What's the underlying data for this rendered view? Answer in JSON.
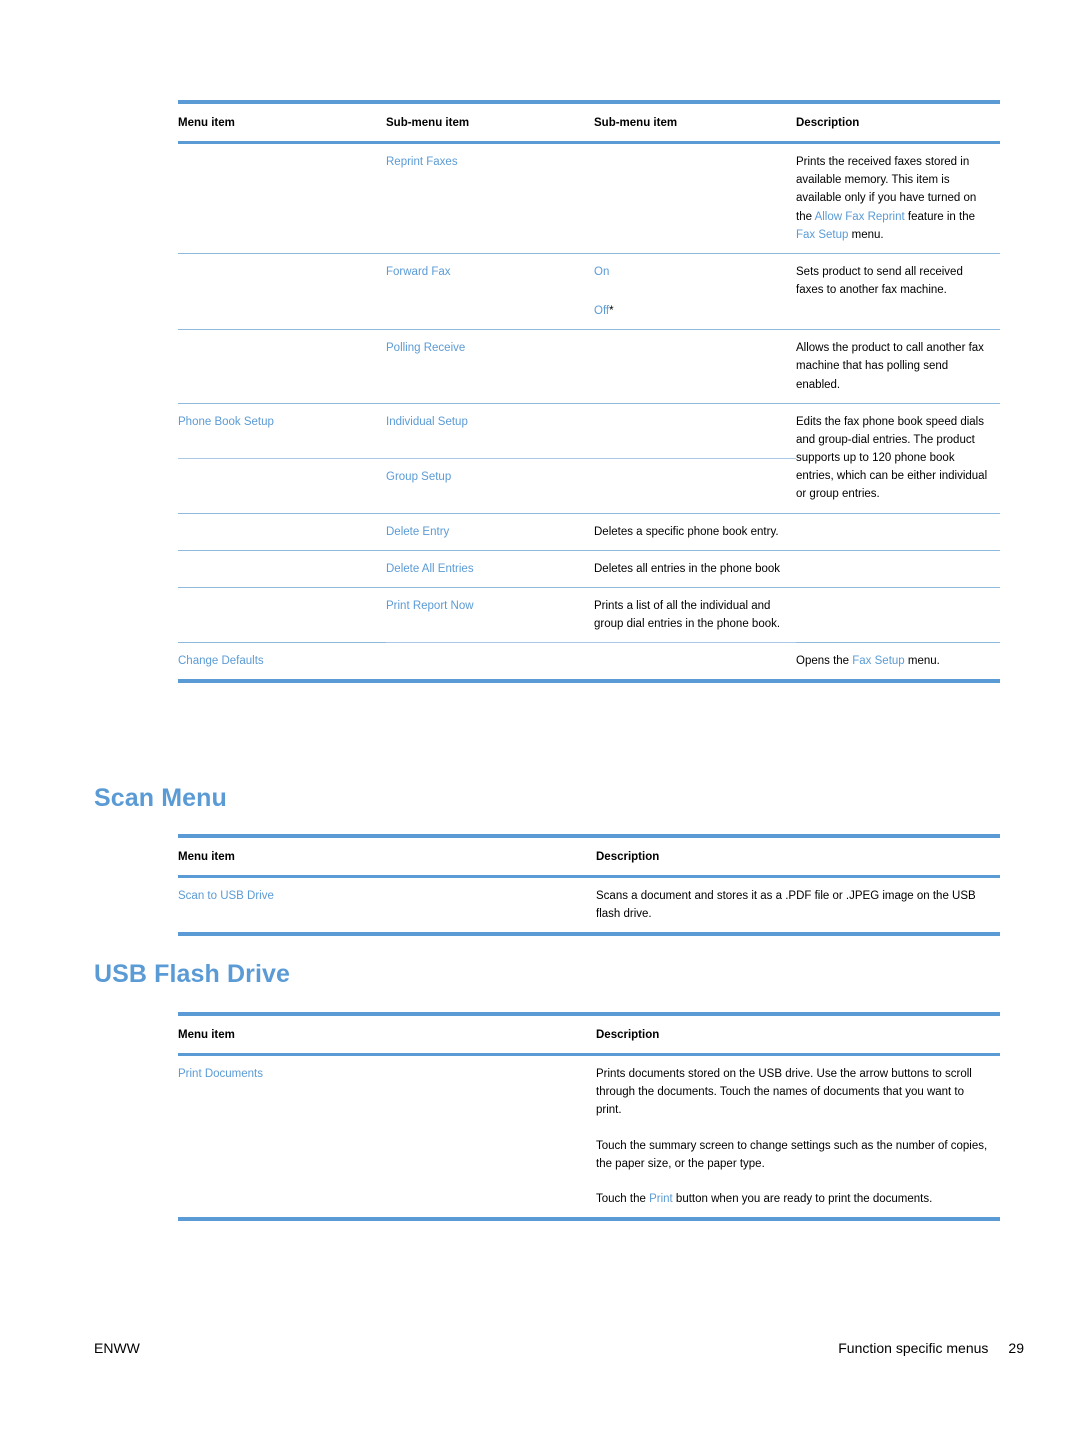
{
  "page": {
    "footer_left": "ENWW",
    "footer_right_label": "Function specific menus",
    "footer_page_number": "29"
  },
  "colors": {
    "accent": "#5b9bd5",
    "rule": "#8fb9dd",
    "text": "#000000"
  },
  "fax_table": {
    "headers": {
      "menu_item": "Menu item",
      "sub_menu_item_1": "Sub-menu item",
      "sub_menu_item_2": "Sub-menu item",
      "description": "Description"
    },
    "rows": [
      {
        "menu_item": "",
        "sub1": "Reprint Faxes",
        "sub2": "",
        "desc_parts": [
          {
            "text": "Prints the received faxes stored in available memory. This item is available only if you have turned on the ",
            "link": false
          },
          {
            "text": "Allow Fax Reprint",
            "link": true
          },
          {
            "text": " feature in the ",
            "link": false
          },
          {
            "text": "Fax Setup",
            "link": true
          },
          {
            "text": " menu.",
            "link": false
          }
        ]
      },
      {
        "menu_item": "",
        "sub1": "Forward Fax",
        "sub2_a": "On",
        "sub2_b": "Off",
        "sub2_b_asterisk": "*",
        "desc": "Sets product to send all received faxes to another fax machine."
      },
      {
        "menu_item": "",
        "sub1": "Polling Receive",
        "sub2": "",
        "desc": "Allows the product to call another fax machine that has polling send enabled."
      },
      {
        "menu_item": "Phone Book Setup",
        "sub1": "Individual Setup",
        "sub1_b": "Group Setup",
        "sub2": "",
        "desc": "Edits the fax phone book speed dials and group-dial entries. The product supports up to 120 phone book entries, which can be either individual or group entries."
      },
      {
        "menu_item": "",
        "sub1": "Delete Entry",
        "sub2": "Deletes a specific phone book entry.",
        "desc": ""
      },
      {
        "menu_item": "",
        "sub1": "Delete All Entries",
        "sub2": "Deletes all entries in the phone book",
        "desc": ""
      },
      {
        "menu_item": "",
        "sub1": "Print Report Now",
        "sub2": "Prints a list of all the individual and group dial entries in the phone book.",
        "desc": ""
      },
      {
        "menu_item": "Change Defaults",
        "sub1": "",
        "sub2": "",
        "desc_parts": [
          {
            "text": "Opens the ",
            "link": false
          },
          {
            "text": "Fax Setup",
            "link": true
          },
          {
            "text": " menu.",
            "link": false
          }
        ]
      }
    ]
  },
  "scan_section": {
    "heading": "Scan Menu",
    "headers": {
      "menu_item": "Menu item",
      "description": "Description"
    },
    "rows": [
      {
        "menu_item": "Scan to USB Drive",
        "desc": "Scans a document and stores it as a .PDF file or .JPEG image on the USB flash drive."
      }
    ]
  },
  "usb_section": {
    "heading": "USB Flash Drive",
    "headers": {
      "menu_item": "Menu item",
      "description": "Description"
    },
    "rows": [
      {
        "menu_item": "Print Documents",
        "desc_p1": "Prints documents stored on the USB drive. Use the arrow buttons to scroll through the documents. Touch the names of documents that you want to print.",
        "desc_p2": "Touch the summary screen to change settings such as the number of copies, the paper size, or the paper type.",
        "desc_p3_parts": [
          {
            "text": "Touch the ",
            "link": false
          },
          {
            "text": "Print",
            "link": true
          },
          {
            "text": " button when you are ready to print the documents.",
            "link": false
          }
        ]
      }
    ]
  }
}
